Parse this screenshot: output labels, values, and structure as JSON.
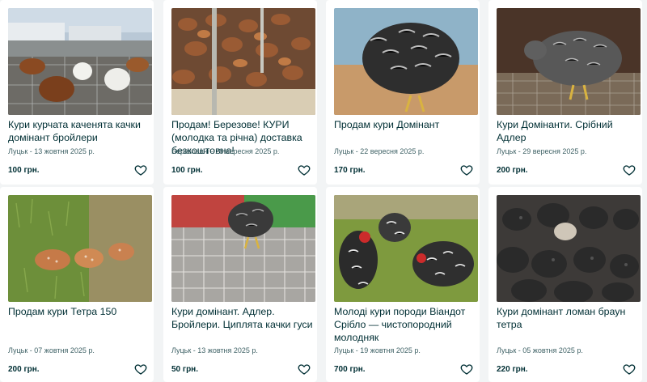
{
  "listings": [
    {
      "title": "Кури курчата каченята качки домінант бройлери",
      "meta": "Луцьк - 13 жовтня 2025 р.",
      "price": "100 грн.",
      "photo": "photo-chickens-farm-yard",
      "favorite_icon": "heart-outline-icon"
    },
    {
      "title": "Продам! Березове! КУРИ (молодка та річна) доставка безкоштовна!",
      "meta": "Березовичі - 28 вересня 2025 р.",
      "price": "100 грн.",
      "photo": "photo-brown-hens-flock",
      "favorite_icon": "heart-outline-icon"
    },
    {
      "title": "Продам кури Домінант",
      "meta": "Луцьк - 22 вересня 2025 р.",
      "price": "170 грн.",
      "photo": "photo-grey-hen-closeup",
      "favorite_icon": "heart-outline-icon"
    },
    {
      "title": "Кури Домінанти. Срібний Адлер",
      "meta": "Луцьк - 29 вересня 2025 р.",
      "price": "200 грн.",
      "photo": "photo-grey-hen-cage",
      "favorite_icon": "heart-outline-icon"
    },
    {
      "title": "Продам кури Тетра 150",
      "meta": "Луцьк - 07 жовтня 2025 р.",
      "price": "200 грн.",
      "photo": "photo-red-hens-grass",
      "favorite_icon": "heart-outline-icon"
    },
    {
      "title": "Кури домінант. Адлер. Бройлери. Циплята качки гуси",
      "meta": "Луцьк - 13 жовтня 2025 р.",
      "price": "50 грн.",
      "photo": "photo-hen-on-crates",
      "favorite_icon": "heart-outline-icon"
    },
    {
      "title": "Молоді кури породи Віандот Срібло — чистопородний молодняк",
      "meta": "Луцьк - 19 жовтня 2025 р.",
      "price": "700 грн.",
      "photo": "photo-wyandotte-hens",
      "favorite_icon": "heart-outline-icon"
    },
    {
      "title": "Кури домінант ломан браун тетра",
      "meta": "Луцьк - 05 жовтня 2025 р.",
      "price": "220 грн.",
      "photo": "photo-dark-hens-group",
      "favorite_icon": "heart-outline-icon"
    }
  ]
}
